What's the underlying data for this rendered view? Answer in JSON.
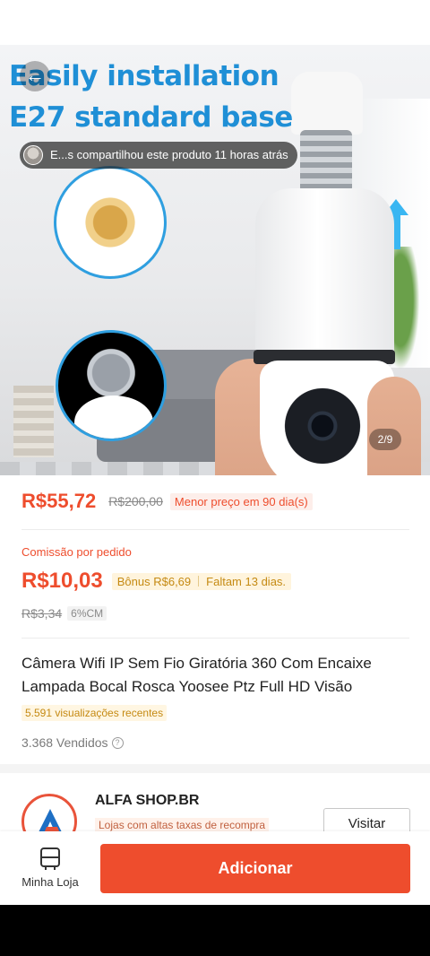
{
  "hero": {
    "headline_line1": "Easily installation",
    "headline_line2": "E27 standard base",
    "share_toast": "E...s compartilhou este produto 11 horas atrás",
    "page_indicator": "2/9"
  },
  "price": {
    "current": "R$55,72",
    "original": "R$200,00",
    "lowest_badge": "Menor preço em 90 dia(s)"
  },
  "commission": {
    "label": "Comissão por pedido",
    "value": "R$10,03",
    "bonus": "Bônus R$6,69",
    "remaining": "Faltam 13 dias.",
    "old_value": "R$3,34",
    "rate": "6%CM"
  },
  "product": {
    "title": "Câmera Wifi IP Sem Fio Giratória 360 Com Encaixe Lampada Bocal Rosca Yoosee Ptz Full HD Visão",
    "views": "5.591 visualizações recentes",
    "sold": "3.368 Vendidos"
  },
  "shop": {
    "name": "ALFA SHOP.BR",
    "tag": "Lojas com altas taxas de recompra",
    "visit_label": "Visitar"
  },
  "bottom": {
    "store_label": "Minha Loja",
    "add_label": "Adicionar"
  },
  "colors": {
    "accent": "#ee4d2d",
    "headline": "#1f8fd6",
    "bonus": "#c58a13"
  },
  "icons": {
    "back": "back-arrow-icon",
    "help": "help-circle-icon",
    "store": "store-icon",
    "logo": "alfa-shop-logo"
  }
}
